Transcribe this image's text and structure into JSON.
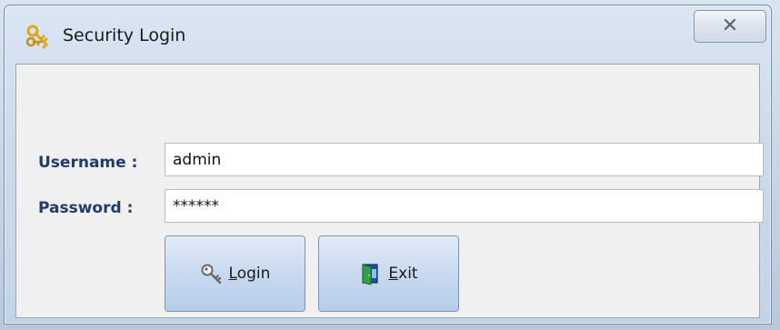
{
  "window": {
    "title": "Security Login",
    "close_label": "✕"
  },
  "form": {
    "username": {
      "label": "Username :",
      "value": "admin"
    },
    "password": {
      "label": "Password :",
      "value": "******"
    }
  },
  "buttons": {
    "login": {
      "mnemonic": "L",
      "rest": "ogin"
    },
    "exit": {
      "mnemonic": "E",
      "rest": "xit"
    }
  },
  "icons": {
    "title": "keys-icon",
    "login": "key-icon",
    "exit": "door-exit-icon",
    "close": "close-icon"
  }
}
